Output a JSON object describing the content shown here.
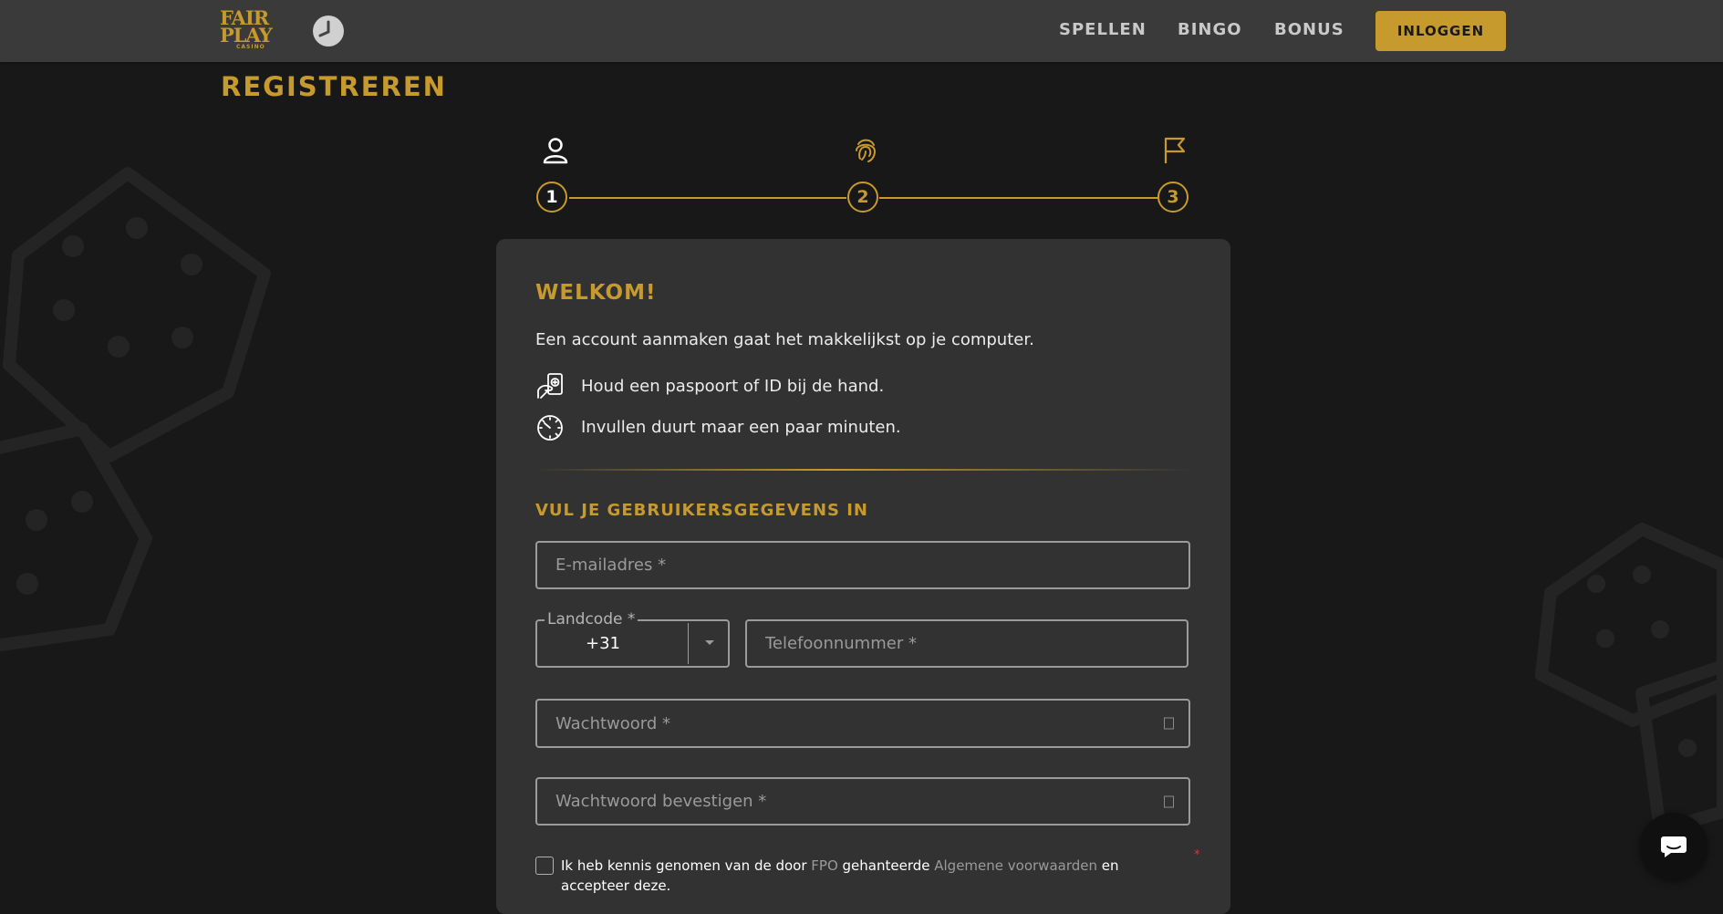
{
  "header": {
    "logo": {
      "line1": "FAIR",
      "line2": "PLAY",
      "line3": "CASINO"
    },
    "clock_icon": "clock-badge-icon",
    "nav": [
      {
        "label": "SPELLEN"
      },
      {
        "label": "BINGO"
      },
      {
        "label": "BONUS"
      }
    ],
    "login_label": "INLOGGEN"
  },
  "page": {
    "title": "REGISTREREN"
  },
  "stepper": {
    "steps": [
      {
        "number": "1",
        "icon": "user-icon",
        "state": "active"
      },
      {
        "number": "2",
        "icon": "fingerprint-icon",
        "state": "upcoming"
      },
      {
        "number": "3",
        "icon": "flag-icon",
        "state": "upcoming"
      }
    ]
  },
  "card": {
    "welcome": "WELKOM!",
    "intro": "Een account aanmaken gaat het makkelijkst op je computer.",
    "info": [
      {
        "icon": "id-card-hand-icon",
        "text": "Houd een paspoort of ID bij de hand."
      },
      {
        "icon": "stopwatch-icon",
        "text": "Invullen duurt maar een paar minuten."
      }
    ],
    "section_title": "VUL JE GEBRUIKERSGEGEVENS IN",
    "email": {
      "placeholder": "E-mailadres *",
      "value": ""
    },
    "country_code": {
      "label": "Landcode *",
      "value": "+31"
    },
    "phone": {
      "placeholder": "Telefoonnummer *",
      "value": ""
    },
    "password": {
      "placeholder": "Wachtwoord *",
      "value": ""
    },
    "password_confirm": {
      "placeholder": "Wachtwoord bevestigen *",
      "value": ""
    },
    "required_mark": "*",
    "terms": {
      "checked": false,
      "part1": "Ik heb kennis genomen van de door ",
      "fpo": "FPO",
      "part2": " gehanteerde ",
      "conditions": "Algemene voorwaarden",
      "part3": " en accepteer deze."
    }
  },
  "chat": {
    "icon": "chat-bubble-icon"
  },
  "colors": {
    "accent": "#c69a2c",
    "header_bg": "#3a3a3a",
    "page_bg": "#181818",
    "card_bg": "#323232"
  }
}
